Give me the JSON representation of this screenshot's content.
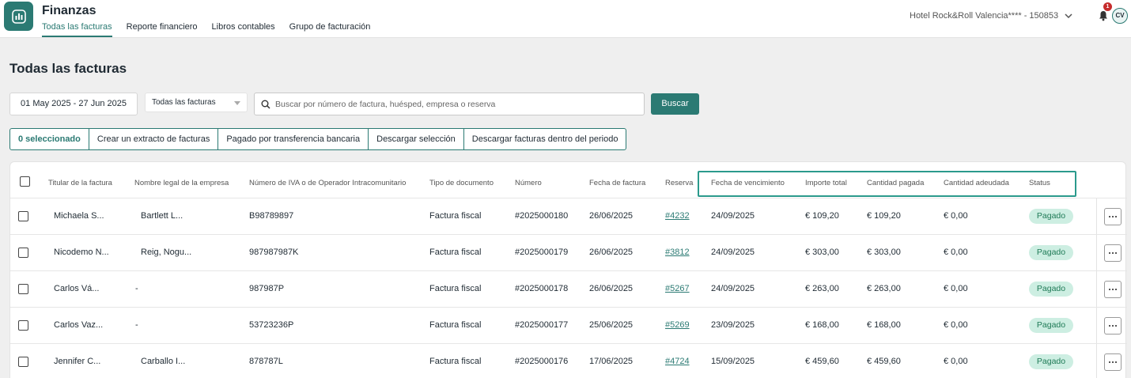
{
  "app": {
    "title": "Finanzas",
    "tabs": [
      "Todas las facturas",
      "Reporte financiero",
      "Libros contables",
      "Grupo de facturación"
    ],
    "active_tab": "Todas las facturas",
    "hotel": "Hotel Rock&Roll Valencia**** - 150853",
    "notification_count": "1",
    "user_initials": "CV",
    "accent_color": "#2b7a73"
  },
  "page": {
    "title": "Todas las facturas"
  },
  "filters": {
    "date_range": "01 May 2025 - 27 Jun 2025",
    "type_select": "Todas las facturas",
    "search_placeholder": "Buscar por número de factura, huésped, empresa o reserva",
    "search_button": "Buscar"
  },
  "actions": [
    "0 seleccionado",
    "Crear un extracto de facturas",
    "Pagado por transferencia bancaria",
    "Descargar selección",
    "Descargar facturas dentro del periodo"
  ],
  "table": {
    "columns": [
      "Titular de la factura",
      "Nombre legal de la empresa",
      "Número de IVA o de Operador Intracomunitario",
      "Tipo de documento",
      "Número",
      "Fecha de factura",
      "Reserva",
      "Fecha de vencimiento",
      "Importe total",
      "Cantidad pagada",
      "Cantidad adeudada",
      "Status"
    ],
    "rows": [
      {
        "holder": "Michaela S...",
        "company": "Bartlett L...",
        "vat": "B98789897",
        "doc_type": "Factura fiscal",
        "number": "#2025000180",
        "invoice_date": "26/06/2025",
        "booking": "#4232",
        "due_date": "24/09/2025",
        "total": "€ 109,20",
        "paid": "€ 109,20",
        "owed": "€ 0,00",
        "status": "Pagado"
      },
      {
        "holder": "Nicodemo N...",
        "company": "Reig, Nogu...",
        "vat": "987987987K",
        "doc_type": "Factura fiscal",
        "number": "#2025000179",
        "invoice_date": "26/06/2025",
        "booking": "#3812",
        "due_date": "24/09/2025",
        "total": "€ 303,00",
        "paid": "€ 303,00",
        "owed": "€ 0,00",
        "status": "Pagado"
      },
      {
        "holder": "Carlos Vá...",
        "company": "-",
        "vat": "987987P",
        "doc_type": "Factura fiscal",
        "number": "#2025000178",
        "invoice_date": "26/06/2025",
        "booking": "#5267",
        "due_date": "24/09/2025",
        "total": "€ 263,00",
        "paid": "€ 263,00",
        "owed": "€ 0,00",
        "status": "Pagado"
      },
      {
        "holder": "Carlos Vaz...",
        "company": "-",
        "vat": "53723236P",
        "doc_type": "Factura fiscal",
        "number": "#2025000177",
        "invoice_date": "25/06/2025",
        "booking": "#5269",
        "due_date": "23/09/2025",
        "total": "€ 168,00",
        "paid": "€ 168,00",
        "owed": "€ 0,00",
        "status": "Pagado"
      },
      {
        "holder": "Jennifer C...",
        "company": "Carballo I...",
        "vat": "878787L",
        "doc_type": "Factura fiscal",
        "number": "#2025000176",
        "invoice_date": "17/06/2025",
        "booking": "#4724",
        "due_date": "15/09/2025",
        "total": "€ 459,60",
        "paid": "€ 459,60",
        "owed": "€ 0,00",
        "status": "Pagado"
      }
    ]
  }
}
